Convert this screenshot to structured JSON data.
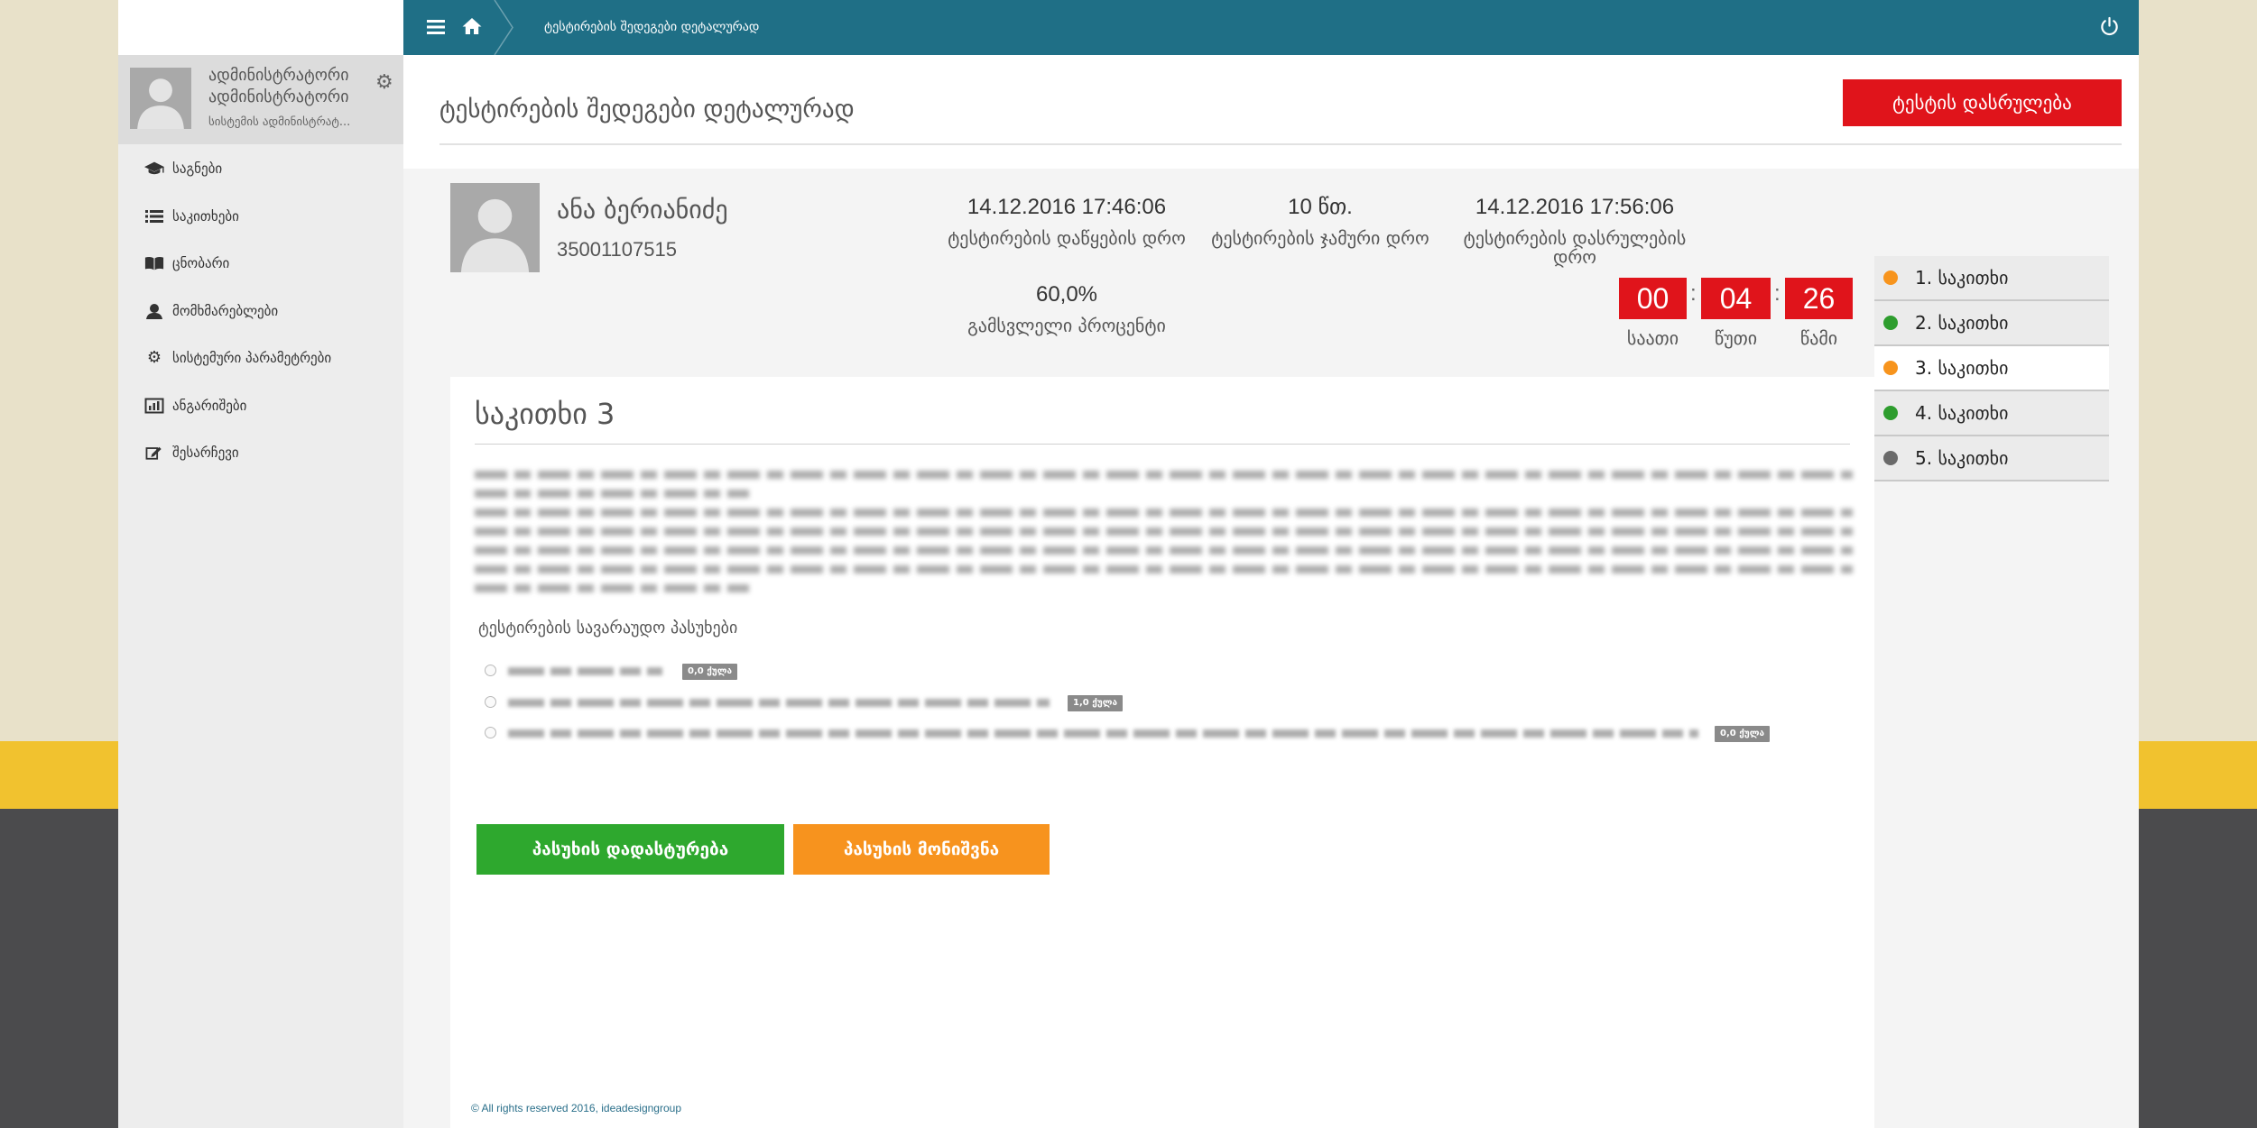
{
  "colors": {
    "topbar": "#1f6f86",
    "danger": "#e0141b",
    "success": "#2ea82e",
    "warning": "#f7931e"
  },
  "topbar": {
    "breadcrumb": "ტესტირების შედეგები დეტალურად",
    "icons": [
      "menu-icon",
      "home-icon",
      "power-icon"
    ]
  },
  "sidebar": {
    "user": {
      "name": "ადმინისტრატორი ადმინისტრატორი",
      "role": "სისტემის ადმინისტრატ..."
    },
    "items": [
      {
        "label": "საგნები",
        "icon": "graduation-cap-icon"
      },
      {
        "label": "საკითხები",
        "icon": "list-icon"
      },
      {
        "label": "ცნობარი",
        "icon": "book-icon"
      },
      {
        "label": "მომხმარებლები",
        "icon": "user-icon"
      },
      {
        "label": "სისტემური პარამეტრები",
        "icon": "gear-icon"
      },
      {
        "label": "ანგარიშები",
        "icon": "bar-chart-icon"
      },
      {
        "label": "შესარჩევი",
        "icon": "edit-icon"
      }
    ]
  },
  "header": {
    "title": "ტესტირების შედეგები დეტალურად",
    "finish_button": "ტესტის დასრულება"
  },
  "candidate": {
    "name": "ანა ბერიანიძე",
    "id": "35001107515"
  },
  "stats": {
    "start": {
      "value": "14.12.2016 17:46:06",
      "label": "ტესტირების დაწყების დრო"
    },
    "pass": {
      "value": "60,0%",
      "label": "გამსვლელი პროცენტი"
    },
    "total": {
      "value": "10 წთ.",
      "label": "ტესტირების ჯამური დრო"
    },
    "end": {
      "value": "14.12.2016 17:56:06",
      "label": "ტესტირების დასრულების დრო"
    }
  },
  "timer": {
    "hours": "00",
    "minutes": "04",
    "seconds": "26",
    "separator": ":",
    "hours_label": "საათი",
    "minutes_label": "წუთი",
    "seconds_label": "წამი"
  },
  "question": {
    "title": "საკითხი 3",
    "answers_heading": "ტესტირების სავარაუდო პასუხები",
    "answers": [
      {
        "points": "0,0 ქულა",
        "selected": false
      },
      {
        "points": "1,0 ქულა",
        "selected": false
      },
      {
        "points": "0,0 ქულა",
        "selected": false
      }
    ]
  },
  "actions": {
    "confirm": "პასუხის დადასტურება",
    "mark": "პასუხის მონიშვნა"
  },
  "question_nav": [
    {
      "label": "1. საკითხი",
      "color": "#f7941d",
      "active": false
    },
    {
      "label": "2. საკითხი",
      "color": "#2e9d2e",
      "active": false
    },
    {
      "label": "3. საკითხი",
      "color": "#f7941d",
      "active": true
    },
    {
      "label": "4. საკითხი",
      "color": "#2e9d2e",
      "active": false
    },
    {
      "label": "5. საკითხი",
      "color": "#6a6a6a",
      "active": false
    }
  ],
  "footer": {
    "copyright": "© All rights reserved 2016, ideadesigngroup"
  }
}
